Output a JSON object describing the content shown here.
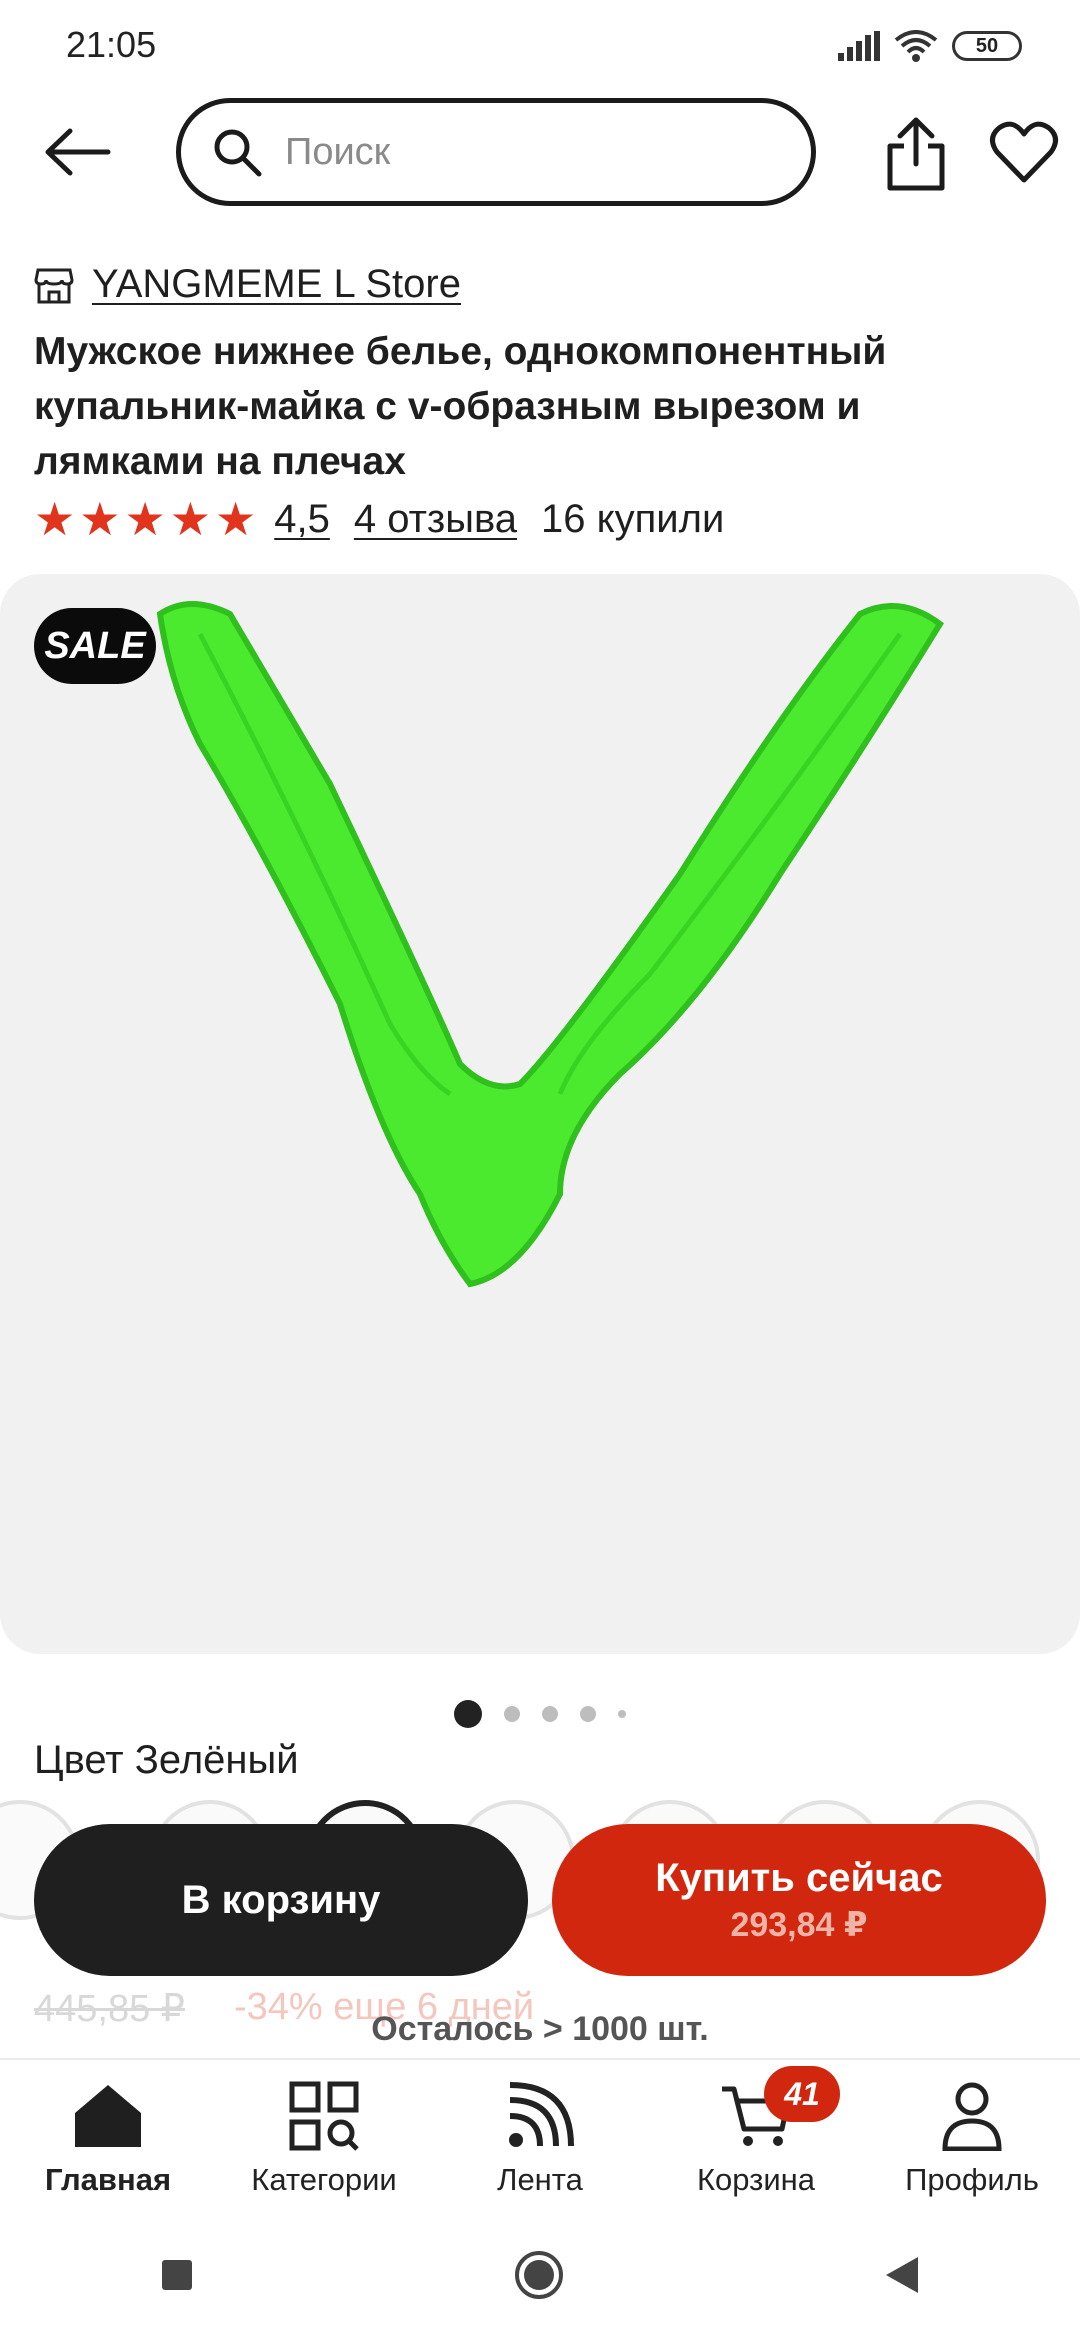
{
  "status_bar": {
    "time": "21:05",
    "battery": "50"
  },
  "header": {
    "search_placeholder": "Поиск",
    "icons": [
      "back-arrow-icon",
      "search-icon",
      "share-icon",
      "heart-icon"
    ]
  },
  "product": {
    "store": "YANGMEME L Store",
    "title": "Мужское нижнее белье, однокомпонентный купальник-майка с v-образным вырезом и лямками на плечах",
    "rating_value": "4,5",
    "rating_stars": 5,
    "reviews": "4 отзыва",
    "bought": "16 купили",
    "sale_badge": "SALE",
    "gallery": {
      "count": 5,
      "current": 1
    },
    "color_label": "Цвет Зелёный",
    "old_price": "445,85 ₽",
    "discount": "-34% еще 6 дней",
    "remaining": "Осталось > 1000 шт.",
    "image_color": "#4cea2e"
  },
  "actions": {
    "cart_label": "В корзину",
    "buy_label": "Купить сейчас",
    "buy_price": "293,84 ₽"
  },
  "nav": {
    "items": [
      {
        "label": "Главная",
        "icon": "home-icon"
      },
      {
        "label": "Категории",
        "icon": "categories-icon"
      },
      {
        "label": "Лента",
        "icon": "feed-icon"
      },
      {
        "label": "Корзина",
        "icon": "cart-icon"
      },
      {
        "label": "Профиль",
        "icon": "profile-icon"
      }
    ],
    "cart_count": "41"
  },
  "colors": {
    "accent": "#d1270e",
    "star": "#e0341c",
    "dark": "#1f1f1f"
  }
}
